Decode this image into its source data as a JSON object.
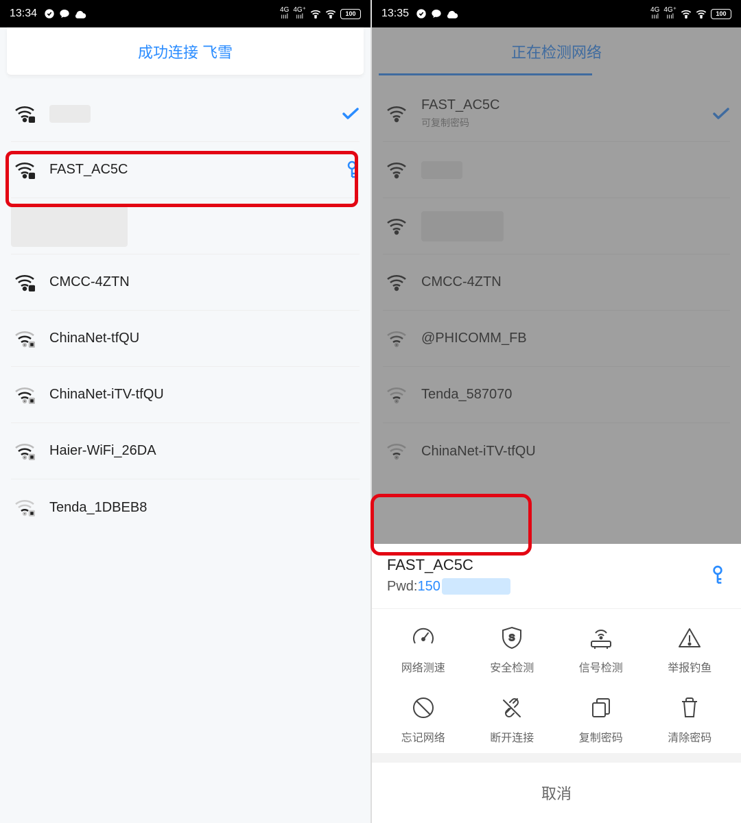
{
  "left": {
    "status": {
      "time": "13:34",
      "battery": "100"
    },
    "banner": "成功连接 飞雪",
    "wifi": [
      {
        "name": "",
        "strength": "strong",
        "trailing": "check",
        "blurred": true
      },
      {
        "name": "FAST_AC5C",
        "strength": "strong",
        "trailing": "key"
      },
      {
        "name": "",
        "strength": "strong",
        "trailing": "",
        "big_blur": true
      },
      {
        "name": "CMCC-4ZTN",
        "strength": "strong",
        "trailing": ""
      },
      {
        "name": "ChinaNet-tfQU",
        "strength": "weak",
        "trailing": ""
      },
      {
        "name": "ChinaNet-iTV-tfQU",
        "strength": "weak",
        "trailing": ""
      },
      {
        "name": "Haier-WiFi_26DA",
        "strength": "weak",
        "trailing": ""
      },
      {
        "name": "Tenda_1DBEB8",
        "strength": "weak",
        "trailing": ""
      }
    ]
  },
  "right": {
    "status": {
      "time": "13:35",
      "battery": "100"
    },
    "banner": "正在检测网络",
    "wifi": [
      {
        "name": "FAST_AC5C",
        "sub": "可复制密码",
        "strength": "strong",
        "trailing": "check"
      },
      {
        "name": "",
        "strength": "strong",
        "blurred": true
      },
      {
        "name": "",
        "strength": "strong",
        "blurred_wide": true
      },
      {
        "name": "CMCC-4ZTN",
        "strength": "strong"
      },
      {
        "name": "@PHICOMM_FB",
        "strength": "weak"
      },
      {
        "name": "Tenda_587070",
        "strength": "weak"
      },
      {
        "name": "ChinaNet-iTV-tfQU",
        "strength": "weak"
      }
    ],
    "sheet": {
      "ssid": "FAST_AC5C",
      "pwd_label": "Pwd:",
      "pwd_value": "150",
      "actions": [
        {
          "label": "网络测速",
          "icon": "gauge"
        },
        {
          "label": "安全检测",
          "icon": "shield"
        },
        {
          "label": "信号检测",
          "icon": "router"
        },
        {
          "label": "举报钓鱼",
          "icon": "warning"
        },
        {
          "label": "忘记网络",
          "icon": "forbid"
        },
        {
          "label": "断开连接",
          "icon": "disconnect"
        },
        {
          "label": "复制密码",
          "icon": "copy"
        },
        {
          "label": "清除密码",
          "icon": "trash"
        }
      ],
      "cancel": "取消"
    }
  }
}
